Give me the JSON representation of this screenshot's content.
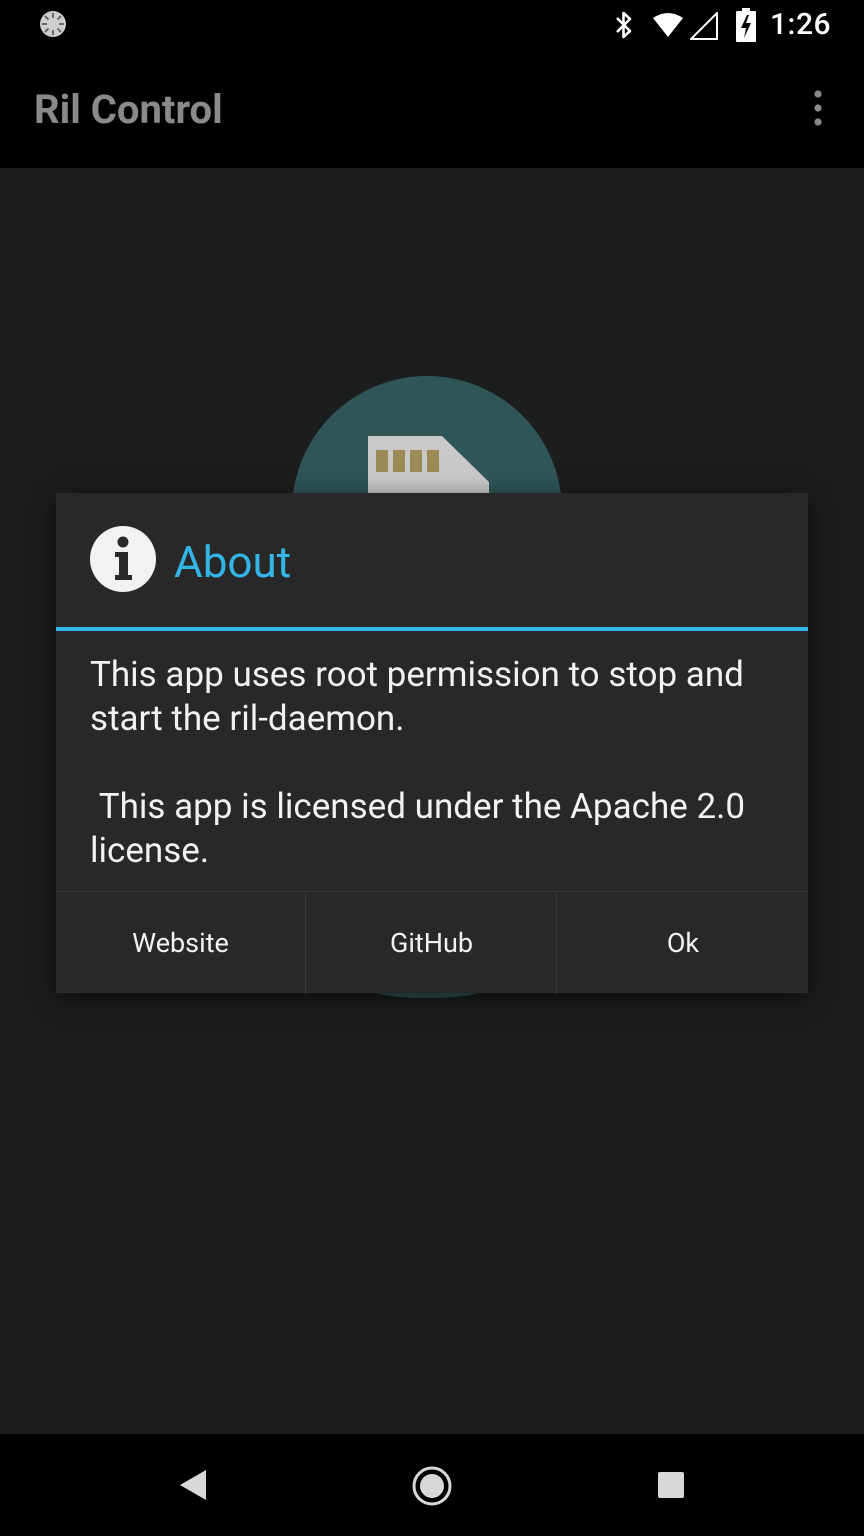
{
  "status_bar": {
    "time": "1:26",
    "icons": [
      "loading-icon",
      "bluetooth-icon",
      "wifi-icon",
      "signal-icon",
      "battery-charging-icon"
    ]
  },
  "app_bar": {
    "title": "Ril Control",
    "overflow_icon": "more-vert-icon"
  },
  "dialog": {
    "icon": "info-icon",
    "title": "About",
    "message": "This app uses root permission to stop and start the ril-daemon.\n\n This app is licensed under the Apache 2.0 license.",
    "buttons": {
      "website": "Website",
      "github": "GitHub",
      "ok": "Ok"
    }
  },
  "nav_bar": {
    "icons": [
      "back-icon",
      "home-icon",
      "recents-icon"
    ]
  },
  "colors": {
    "accent": "#33b5e5",
    "dialog_bg": "#282828",
    "hero_circle": "#2f5557",
    "sim_card": "#c9c9c9",
    "sim_contacts": "#9c8a57"
  }
}
